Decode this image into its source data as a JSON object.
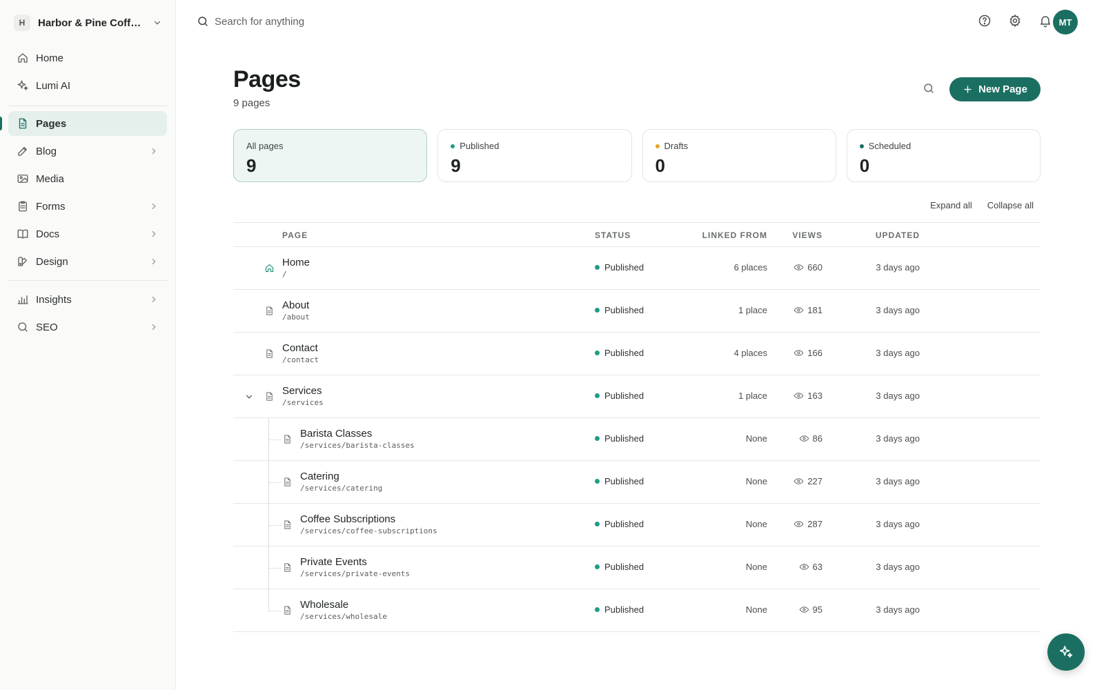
{
  "workspace": {
    "initial": "H",
    "name": "Harbor & Pine Coffee"
  },
  "nav": {
    "primary": [
      {
        "label": "Home",
        "icon": "home-icon"
      },
      {
        "label": "Lumi AI",
        "icon": "sparkles-icon"
      }
    ],
    "content": [
      {
        "label": "Pages",
        "icon": "page-icon",
        "active": true
      },
      {
        "label": "Blog",
        "icon": "edit-icon",
        "has_children": true
      },
      {
        "label": "Media",
        "icon": "image-icon"
      },
      {
        "label": "Forms",
        "icon": "form-icon",
        "has_children": true
      },
      {
        "label": "Docs",
        "icon": "book-icon",
        "has_children": true
      },
      {
        "label": "Design",
        "icon": "palette-icon",
        "has_children": true
      }
    ],
    "analytics": [
      {
        "label": "Insights",
        "icon": "bar-chart-icon",
        "has_children": true
      },
      {
        "label": "SEO",
        "icon": "search-icon",
        "has_children": true
      }
    ]
  },
  "topbar": {
    "search_placeholder": "Search for anything",
    "avatar_initials": "MT"
  },
  "header": {
    "title": "Pages",
    "count": "9 pages",
    "new_button": "New Page"
  },
  "stats": [
    {
      "label": "All pages",
      "value": "9",
      "dot": null
    },
    {
      "label": "Published",
      "value": "9",
      "dot": "#1f9d86"
    },
    {
      "label": "Drafts",
      "value": "0",
      "dot": "#e3a52b"
    },
    {
      "label": "Scheduled",
      "value": "0",
      "dot": "#1b6f62"
    }
  ],
  "tree_controls": {
    "expand": "Expand all",
    "collapse": "Collapse all"
  },
  "table": {
    "columns": {
      "page": "PAGE",
      "status": "STATUS",
      "linked": "LINKED FROM",
      "views": "VIEWS",
      "updated": "UPDATED"
    },
    "rows": [
      {
        "name": "Home",
        "slug": "/",
        "status": "Published",
        "linked": "6 places",
        "views": "660",
        "updated": "3 days ago",
        "level": 0,
        "icon": "home-icon"
      },
      {
        "name": "About",
        "slug": "/about",
        "status": "Published",
        "linked": "1 place",
        "views": "181",
        "updated": "3 days ago",
        "level": 0,
        "icon": "page-icon"
      },
      {
        "name": "Contact",
        "slug": "/contact",
        "status": "Published",
        "linked": "4 places",
        "views": "166",
        "updated": "3 days ago",
        "level": 0,
        "icon": "page-icon"
      },
      {
        "name": "Services",
        "slug": "/services",
        "status": "Published",
        "linked": "1 place",
        "views": "163",
        "updated": "3 days ago",
        "level": 0,
        "icon": "page-icon",
        "expanded": true
      },
      {
        "name": "Barista Classes",
        "slug": "/services/barista-classes",
        "status": "Published",
        "linked": "None",
        "views": "86",
        "updated": "3 days ago",
        "level": 1,
        "icon": "page-icon"
      },
      {
        "name": "Catering",
        "slug": "/services/catering",
        "status": "Published",
        "linked": "None",
        "views": "227",
        "updated": "3 days ago",
        "level": 1,
        "icon": "page-icon"
      },
      {
        "name": "Coffee Subscriptions",
        "slug": "/services/coffee-subscriptions",
        "status": "Published",
        "linked": "None",
        "views": "287",
        "updated": "3 days ago",
        "level": 1,
        "icon": "page-icon"
      },
      {
        "name": "Private Events",
        "slug": "/services/private-events",
        "status": "Published",
        "linked": "None",
        "views": "63",
        "updated": "3 days ago",
        "level": 1,
        "icon": "page-icon"
      },
      {
        "name": "Wholesale",
        "slug": "/services/wholesale",
        "status": "Published",
        "linked": "None",
        "views": "95",
        "updated": "3 days ago",
        "level": 1,
        "icon": "page-icon"
      }
    ]
  },
  "fab": {
    "icon": "sparkles-icon"
  }
}
